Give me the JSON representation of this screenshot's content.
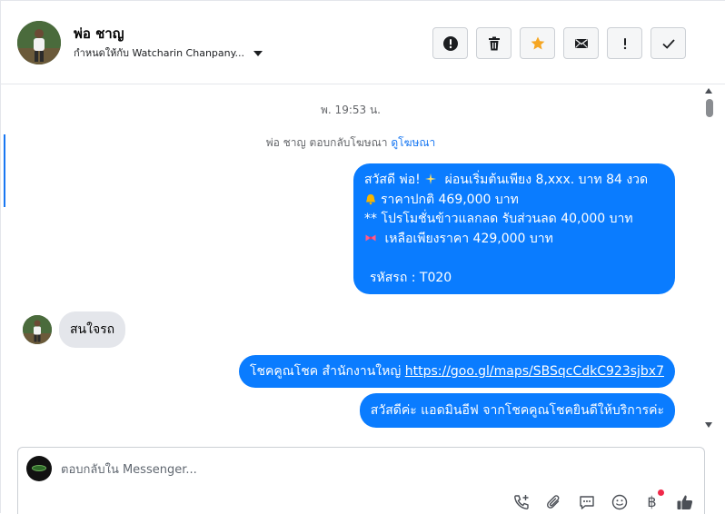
{
  "header": {
    "contact_name": "พ่อ ชาญ",
    "assigned_to": "กำหนดให้กับ Watcharin Chanpany...",
    "actions": [
      {
        "name": "mark-spam-button",
        "icon": "exclamation-circle-icon"
      },
      {
        "name": "delete-button",
        "icon": "trash-icon"
      },
      {
        "name": "star-button",
        "icon": "star-icon"
      },
      {
        "name": "mark-unread-button",
        "icon": "envelope-icon"
      },
      {
        "name": "follow-up-button",
        "icon": "exclamation-icon"
      },
      {
        "name": "mark-done-button",
        "icon": "check-icon"
      }
    ]
  },
  "messages": {
    "time_separator": "พ. 19:53 น.",
    "reply_note": {
      "text": "พ่อ ชาญ ตอบกลับโฆษณา ",
      "link": "ดูโฆษณา"
    },
    "outgoing_1": {
      "line1": "สวัสดี พ่อ!",
      "line1_rest": " ผ่อนเริ่มต้นเพียง 8,xxx. บาท 84 งวด",
      "line2": "ราคาปกติ 469,000 บาท",
      "line3": "** โปรโมชั่นข้าวแลกลด รับส่วนลด 40,000 บาท",
      "line4": " เหลือเพียงราคา 429,000 บาท",
      "line5": "รหัสรถ : T020"
    },
    "incoming_1": "สนใจรถ",
    "outgoing_2": {
      "text": "โชคคูณโชค สำนักงานใหญ่ ",
      "link": "https://goo.gl/maps/SBSqcCdkC923sjbx7"
    },
    "outgoing_3": "สวัสดีค่ะ แอดมินอีฟ จากโชคคูณโชคยินดีให้บริการค่ะ"
  },
  "composer": {
    "placeholder": "ตอบกลับใน Messenger...",
    "tools": [
      "call-add-icon",
      "paperclip-icon",
      "chat-bubble-icon",
      "smiley-icon",
      "baht-icon",
      "thumbs-up-icon"
    ],
    "baht_symbol": "฿"
  },
  "colors": {
    "outgoing_bubble": "#0a7cff",
    "incoming_bubble": "#e4e6eb",
    "accent": "#1877f2",
    "star": "#f5a623"
  }
}
